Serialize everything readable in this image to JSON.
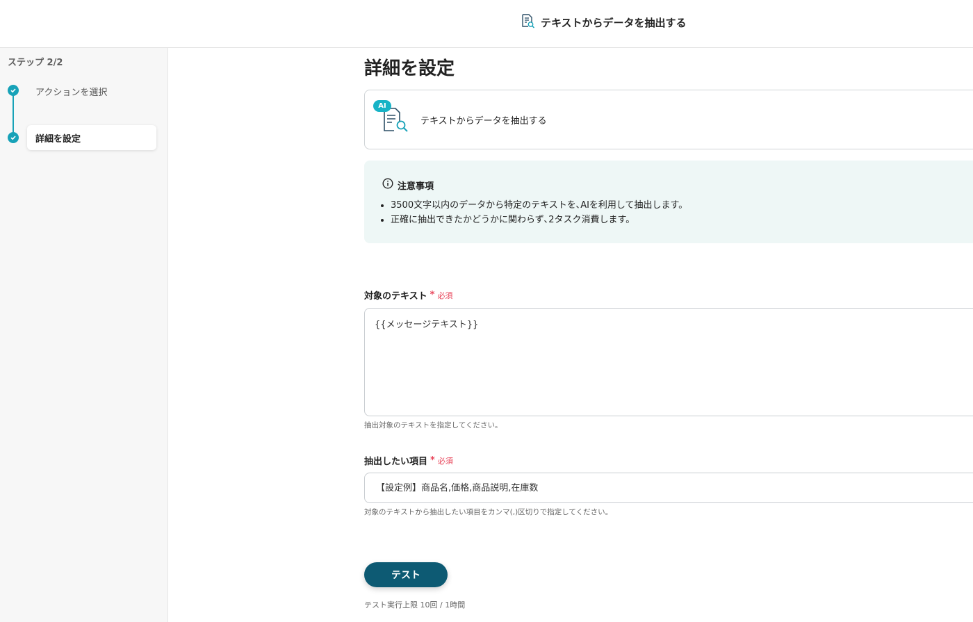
{
  "header": {
    "title": "テキストからデータを抽出する",
    "icon": "document-search-icon"
  },
  "sidebar": {
    "step_label": "ステップ 2/2",
    "steps": [
      {
        "label": "アクションを選択",
        "status": "done"
      },
      {
        "label": "詳細を設定",
        "status": "active"
      }
    ]
  },
  "main": {
    "page_title": "詳細を設定",
    "action_card": {
      "badge": "AI",
      "name": "テキストからデータを抽出する"
    },
    "notice": {
      "title": "注意事項",
      "items": [
        "3500文字以内のデータから特定のテキストを､AIを利用して抽出します。",
        "正確に抽出できたかどうかに関わらず､2タスク消費します。"
      ]
    },
    "fields": {
      "target_text": {
        "label": "対象のテキスト",
        "required_mark": "*",
        "required_text": "必須",
        "value": "{{メッセージテキスト}}",
        "help": "抽出対象のテキストを指定してください。"
      },
      "extract_items": {
        "label": "抽出したい項目",
        "required_mark": "*",
        "required_text": "必須",
        "placeholder": "【設定例】商品名,価格,商品説明,在庫数",
        "help": "対象のテキストから抽出したい項目をカンマ(,)区切りで指定してください。"
      }
    },
    "test_button": "テスト",
    "limit_text": "テスト実行上限 10回 / 1時間"
  },
  "colors": {
    "accent": "#17a2b8",
    "button": "#0d5a73",
    "required": "#e8455a",
    "notice_bg": "#eef7f6"
  }
}
